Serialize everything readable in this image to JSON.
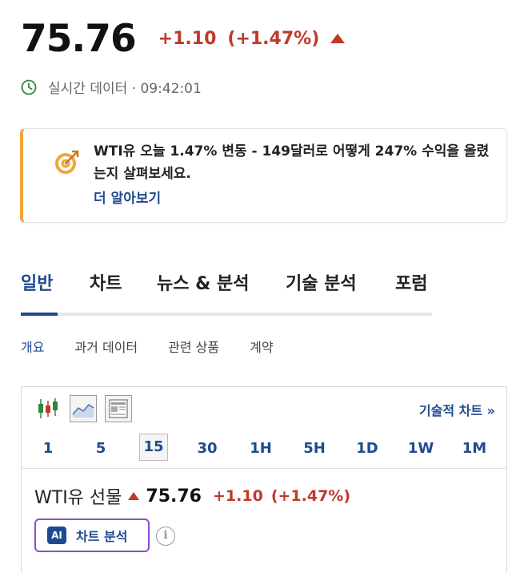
{
  "quote": {
    "price": "75.76",
    "change": "+1.10",
    "change_pct": "(+1.47%)"
  },
  "realtime": {
    "label": "실시간 데이터 · 09:42:01"
  },
  "promo": {
    "text": "WTI유 오늘 1.47% 변동 - 149달러로 어떻게 247% 수익을 올렸는지 살펴보세요.",
    "link": "더 알아보기"
  },
  "tabs": [
    "일반",
    "차트",
    "뉴스 & 분석",
    "기술 분석",
    "포럼"
  ],
  "subtabs": [
    "개요",
    "과거 데이터",
    "관련 상품",
    "계약"
  ],
  "chart_widget": {
    "tech_chart_link": "기술적 차트 »",
    "timeframes": [
      "1",
      "5",
      "15",
      "30",
      "1H",
      "5H",
      "1D",
      "1W",
      "1M"
    ],
    "selected_timeframe": "15"
  },
  "instrument": {
    "name": "WTI유 선물",
    "price": "75.76",
    "change": "+1.10",
    "change_pct": "(+1.47%)"
  },
  "ai": {
    "badge": "AI",
    "label": "차트 분석"
  },
  "icons": {
    "clock": "clock-icon",
    "target": "target-icon",
    "candlestick": "candlestick-icon",
    "area_chart": "area-chart-icon",
    "news": "news-icon",
    "info": "info-icon"
  },
  "colors": {
    "up": "#c0392b",
    "accent": "#1f4b8e",
    "promo_border": "#f0a63a",
    "ai_border": "#8a4fd1"
  }
}
